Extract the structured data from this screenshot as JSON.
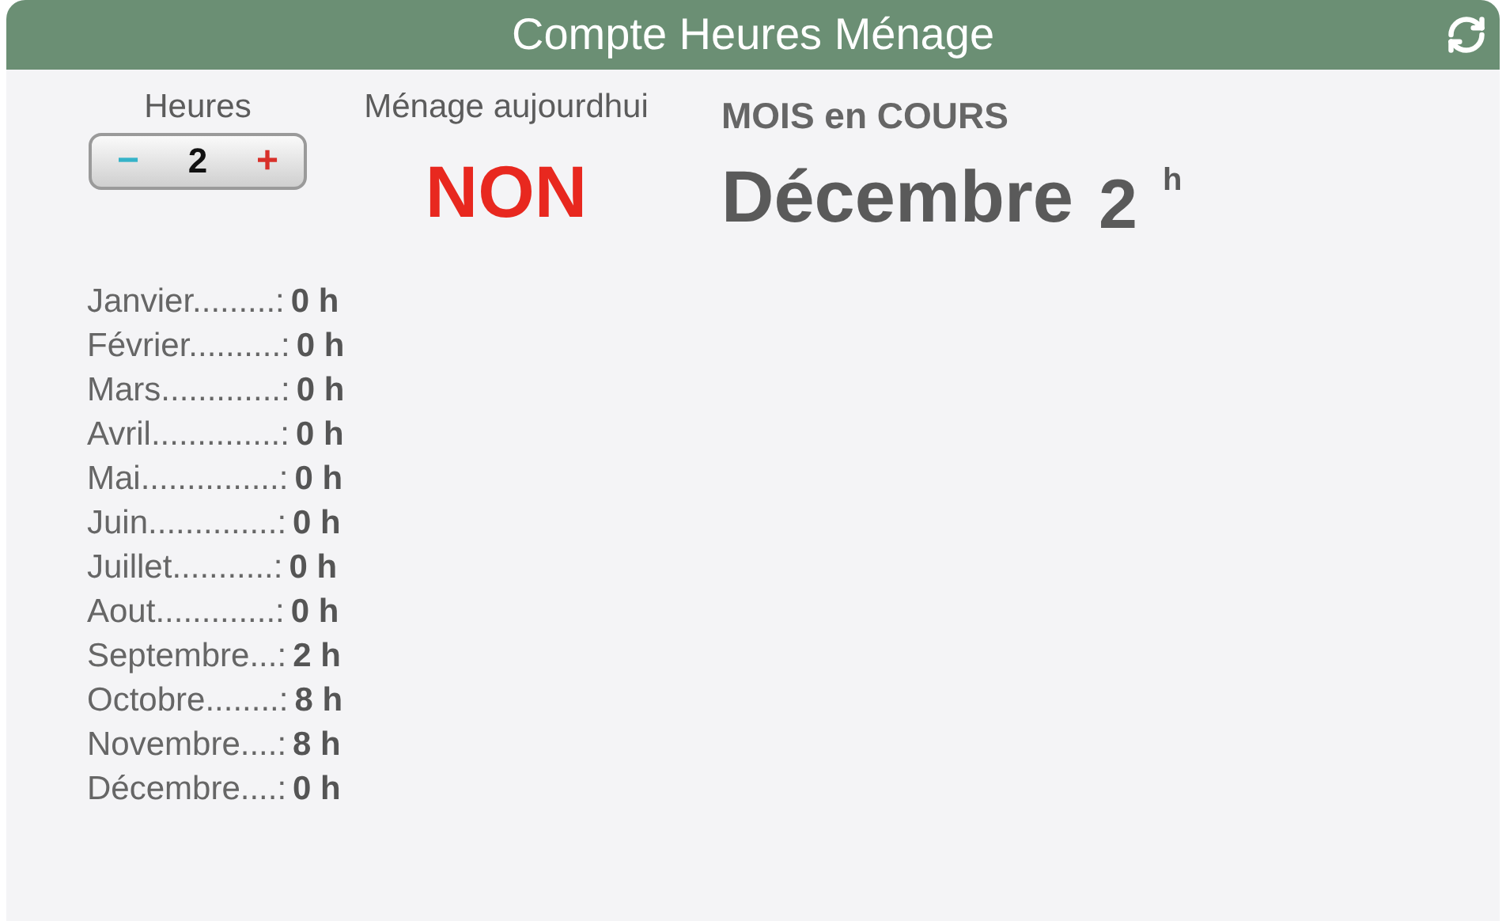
{
  "window": {
    "title": "Compte Heures Ménage"
  },
  "hours": {
    "label": "Heures",
    "minus": "−",
    "value": "2",
    "plus": "+"
  },
  "today": {
    "label": "Ménage aujourdhui",
    "value": "NON"
  },
  "current": {
    "label": "MOIS en COURS",
    "month": "Décembre",
    "hours": "2",
    "unit": "h"
  },
  "months": [
    {
      "label": "Janvier.........:",
      "value": "0 h"
    },
    {
      "label": "Février..........:",
      "value": "0 h"
    },
    {
      "label": "Mars.............:",
      "value": "0 h"
    },
    {
      "label": "Avril..............:",
      "value": "0 h"
    },
    {
      "label": "Mai...............:",
      "value": "0 h"
    },
    {
      "label": "Juin..............:",
      "value": "0 h"
    },
    {
      "label": "Juillet...........:",
      "value": "0 h"
    },
    {
      "label": "Aout.............:",
      "value": "0 h"
    },
    {
      "label": "Septembre...:",
      "value": "2 h"
    },
    {
      "label": "Octobre........:",
      "value": "8 h"
    },
    {
      "label": "Novembre....:",
      "value": "8 h"
    },
    {
      "label": "Décembre....:",
      "value": "0 h"
    }
  ]
}
